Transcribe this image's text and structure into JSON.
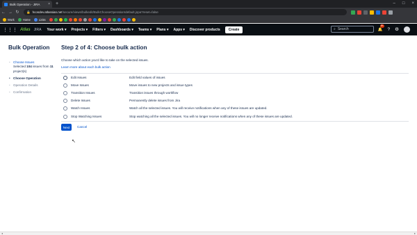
{
  "browser": {
    "tab_title": "Bulk Operation - JIRA",
    "tab_close": "×",
    "new_tab": "+",
    "window_controls": [
      "–",
      "□",
      "×"
    ],
    "back": "←",
    "forward": "→",
    "reload": "↻",
    "url_host": "hcosdev.atlassian.net",
    "url_path": "/secure/views/bulkedit/BulkChooseOperation!default.jspa?reset=false",
    "bookmarks": [
      {
        "label": "Work",
        "color": "#fbbc04"
      },
      {
        "label": "Home",
        "color": "#34a853"
      },
      {
        "label": "Links",
        "color": "#4285f4"
      }
    ],
    "extensions_colors": [
      "#34a853",
      "#ea4335",
      "#5f6368",
      "#fbbc04",
      "#1a73e8",
      "#ea4335",
      "#9aa0a6"
    ]
  },
  "jira_header": {
    "grid_icon": "⋮⋮⋮",
    "logo": "Atlas",
    "product": "JIRA",
    "nav": [
      "Your work ▾",
      "Projects ▾",
      "Filters ▾",
      "Dashboards ▾",
      "Teams ▾",
      "Plans ▾",
      "Apps ▾",
      "Discover products"
    ],
    "create_label": "Create",
    "search_icon": "⌕",
    "search_placeholder": "Search",
    "notification_count": "9+",
    "icons": {
      "notifications": "🔔",
      "help": "?",
      "settings": "⚙"
    }
  },
  "sidebar": {
    "title": "Bulk Operation",
    "steps": [
      {
        "label": "Choose Issues",
        "state": "done"
      },
      {
        "label": "Choose Operation",
        "state": "active"
      },
      {
        "label": "Operation Details",
        "state": "todo"
      },
      {
        "label": "Confirmation",
        "state": "todo"
      }
    ],
    "selected_prefix": "Selected ",
    "selected_count": "104",
    "selected_mid": " issues from ",
    "selected_projects": "11",
    "selected_suffix": " project(s)",
    "bullet": "•"
  },
  "main": {
    "title": "Step 2 of 4: Choose bulk action",
    "intro": "Choose which action you'd like to take on the selected issues.",
    "learn_more": "Learn more about each bulk action",
    "operations": [
      {
        "label": "Edit Issues",
        "description": "Edit field values of issues"
      },
      {
        "label": "Move Issues",
        "description": "Move issues to new projects and issue types"
      },
      {
        "label": "Transition Issues",
        "description": "Transition issues through workflow"
      },
      {
        "label": "Delete Issues",
        "description": "Permanently delete issues from Jira"
      },
      {
        "label": "Watch Issues",
        "description": "Watch all the selected issues. You will receive notifications when any of these issues are updated."
      },
      {
        "label": "Stop Watching Issues",
        "description": "Stop watching all the selected issues. You will no longer receive notifications when any of these issues are updated."
      }
    ],
    "next_label": "Next",
    "cancel_label": "Cancel"
  },
  "cursor": "↖"
}
